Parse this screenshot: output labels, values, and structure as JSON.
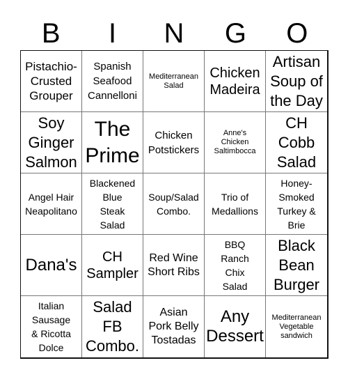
{
  "title_letters": [
    "B",
    "I",
    "N",
    "G",
    "O"
  ],
  "cells": [
    {
      "text": "Pistachio-\nCrusted\nGrouper",
      "size": "s17"
    },
    {
      "text": "Spanish\nSeafood\nCannelloni",
      "size": "s15"
    },
    {
      "text": "Mediterranean\nSalad",
      "size": "s11"
    },
    {
      "text": "Chicken\nMadeira",
      "size": "s20"
    },
    {
      "text": "Artisan\nSoup of\nthe Day",
      "size": "s22"
    },
    {
      "text": "Soy\nGinger\nSalmon",
      "size": "s22"
    },
    {
      "text": "The\nPrime",
      "size": "s30"
    },
    {
      "text": "Chicken\nPotstickers",
      "size": "s15"
    },
    {
      "text": "Anne's\nChicken\nSaltimbocca",
      "size": "s11"
    },
    {
      "text": "CH\nCobb\nSalad",
      "size": "s22"
    },
    {
      "text": "Angel Hair\nNeapolitano",
      "size": "s14"
    },
    {
      "text": "Blackened\nBlue\nSteak\nSalad",
      "size": "s14"
    },
    {
      "text": "Soup/Salad\nCombo.",
      "size": "s14"
    },
    {
      "text": "Trio of\nMedallions",
      "size": "s14"
    },
    {
      "text": "Honey-\nSmoked\nTurkey &\nBrie",
      "size": "s14"
    },
    {
      "text": "Dana's",
      "size": "s24"
    },
    {
      "text": "CH\nSampler",
      "size": "s20"
    },
    {
      "text": "Red Wine\nShort Ribs",
      "size": "s16"
    },
    {
      "text": "BBQ\nRanch\nChix\nSalad",
      "size": "s14"
    },
    {
      "text": "Black\nBean\nBurger",
      "size": "s22"
    },
    {
      "text": "Italian\nSausage\n& Ricotta\nDolce",
      "size": "s14"
    },
    {
      "text": "Salad\nFB\nCombo.",
      "size": "s22"
    },
    {
      "text": "Asian\nPork Belly\nTostadas",
      "size": "s16"
    },
    {
      "text": "Any\nDessert",
      "size": "s24"
    },
    {
      "text": "Mediterranean\nVegetable\nsandwich",
      "size": "s11"
    }
  ]
}
